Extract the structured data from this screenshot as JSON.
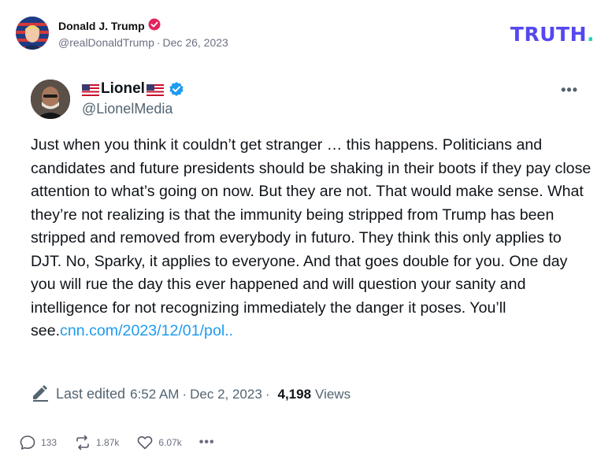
{
  "author": {
    "name": "Donald J. Trump",
    "handle": "@realDonaldTrump",
    "separator": "·",
    "date": "Dec 26, 2023"
  },
  "brand": {
    "text": "TRUTH",
    "dot": "."
  },
  "embed": {
    "name": "Lionel",
    "handle": "@LionelMedia",
    "more": "•••",
    "body_text": "Just when you think it couldn’t get stranger … this happens. Politicians and candidates and future presidents should be shaking in their boots if they pay close attention to what’s going on now. But they are not. That would make sense. What they’re not realizing is that the immunity being stripped from Trump has been stripped and removed from everybody in futuro. They think this only applies to DJT. No, Sparky, it applies to everyone. And that goes double for you. One day you will rue the day this ever happened and will question your sanity and intelligence for not recognizing immediately the danger it poses. You’ll see.",
    "link": "cnn.com/2023/12/01/pol..",
    "last_edited_label": "Last edited",
    "edited_time": "6:52 AM",
    "edited_date": "Dec 2, 2023",
    "views_count": "4,198",
    "views_label": "Views"
  },
  "actions": {
    "replies": "133",
    "retruths": "1.87k",
    "likes": "6.07k",
    "more": "•••"
  },
  "colors": {
    "brand": "#5448ee",
    "brand_dot": "#21d1b5",
    "verified_red": "#e0245e",
    "verified_blue": "#1d9bf0",
    "link": "#1d9bf0"
  }
}
